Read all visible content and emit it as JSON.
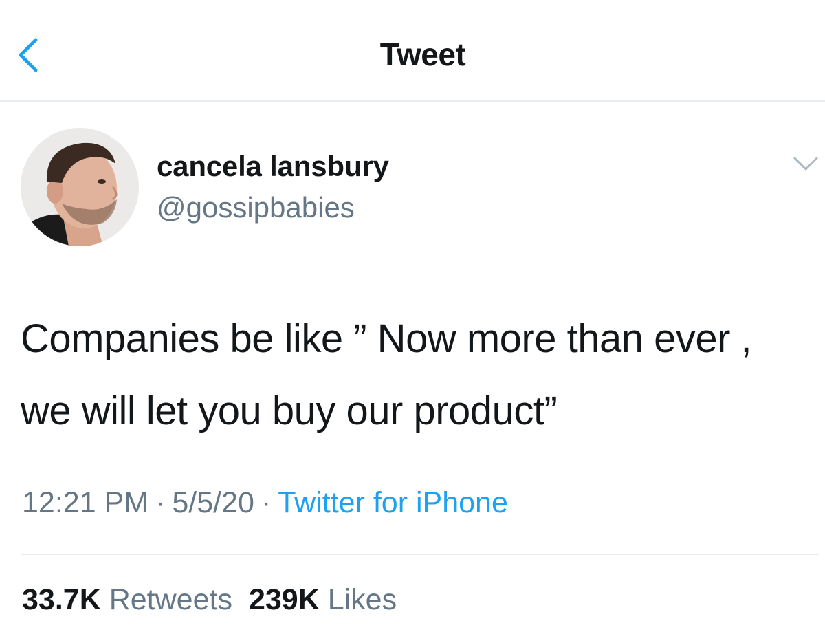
{
  "header": {
    "title": "Tweet",
    "back_icon": "chevron-left-icon",
    "accent_color": "#1da1f2"
  },
  "tweet": {
    "author": {
      "display_name": "cancela lansbury",
      "handle": "@gossipbabies"
    },
    "text": "Companies be like ” Now more than ever , we will let you buy our product”",
    "time": "12:21 PM",
    "date": "5/5/20",
    "separator": "·",
    "source": "Twitter for iPhone",
    "stats": {
      "retweets_count": "33.7K",
      "retweets_label": "Retweets",
      "likes_count": "239K",
      "likes_label": "Likes"
    }
  },
  "colors": {
    "text_primary": "#14171a",
    "text_secondary": "#657786",
    "link": "#1da1f2",
    "divider": "#e6ecf0"
  }
}
